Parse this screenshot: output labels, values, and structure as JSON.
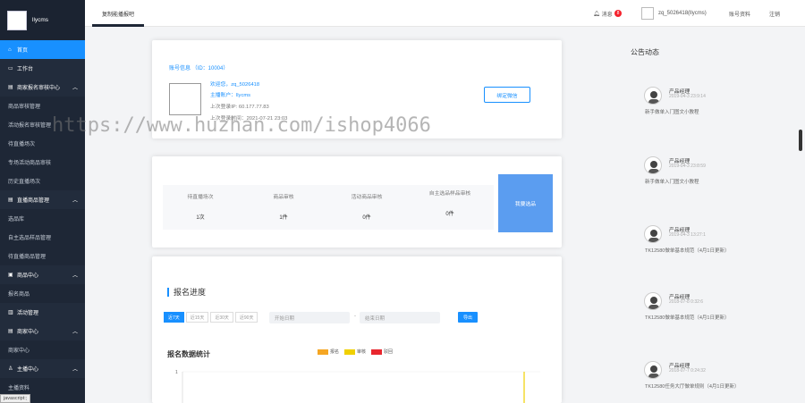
{
  "sidebar": {
    "brand": "llycms",
    "items": [
      {
        "label": "首页",
        "icon": "⌂",
        "type": "active"
      },
      {
        "label": "工作台",
        "icon": "▭",
        "type": "group"
      },
      {
        "label": "商家报名审核中心",
        "icon": "▤",
        "type": "group",
        "caret": "︿"
      },
      {
        "label": "商品审核管理",
        "type": "item"
      },
      {
        "label": "活动报名审核管理",
        "type": "item"
      },
      {
        "label": "待直播场次",
        "type": "item"
      },
      {
        "label": "专场活动商品审核",
        "type": "item"
      },
      {
        "label": "历史直播场次",
        "type": "item"
      },
      {
        "label": "直播商品管理",
        "icon": "▤",
        "type": "group",
        "caret": "︿"
      },
      {
        "label": "选品库",
        "type": "item"
      },
      {
        "label": "自主选品样品管理",
        "type": "item"
      },
      {
        "label": "待直播商品管理",
        "type": "item"
      },
      {
        "label": "商品中心",
        "icon": "▣",
        "type": "group",
        "caret": "︿"
      },
      {
        "label": "报名商品",
        "type": "item"
      },
      {
        "label": "活动管理",
        "icon": "▥",
        "type": "group"
      },
      {
        "label": "商家中心",
        "icon": "▤",
        "type": "group",
        "caret": "︿"
      },
      {
        "label": "商家中心",
        "type": "item"
      },
      {
        "label": "主播中心",
        "icon": "♙",
        "type": "group",
        "caret": "︿"
      },
      {
        "label": "主播资料",
        "type": "item"
      }
    ],
    "status_text": "javascript:;"
  },
  "topbar": {
    "tab_label": "复制能播报吧",
    "bell_icon": "bell-icon",
    "messages_label": "消息",
    "messages_count": "8",
    "username": "zq_5026418(llycms)",
    "account_label": "账号资料",
    "logout_label": "注销"
  },
  "account": {
    "title": "账号信息 （ID：10004）",
    "welcome_prefix": "欢迎您，",
    "welcome_user": "zq_5026418",
    "anchor": "主播账户：llycms",
    "last_ip": "上次登录IP: 60.177.77.83",
    "last_time": "上次登录时间：2021-07-21 23:03",
    "bind_button": "绑定微信"
  },
  "stats": {
    "items": [
      {
        "label": "待直播场次",
        "value": "1次"
      },
      {
        "label": "商品审核",
        "value": "1件"
      },
      {
        "label": "活动商品审核",
        "value": "0件"
      },
      {
        "label": "自主选品样品审核",
        "value": "0件"
      }
    ],
    "action_button": "我要选品"
  },
  "progress": {
    "title": "报名进度",
    "ranges": [
      "近7天",
      "近15天",
      "近30天",
      "近90天"
    ],
    "start_placeholder": "开始日期",
    "separator": "-",
    "end_placeholder": "结束日期",
    "export_button": "导出",
    "chart_title": "报名数据统计"
  },
  "chart_data": {
    "type": "line",
    "title": "报名数据统计",
    "series": [
      {
        "name": "报名",
        "color": "#f5a623"
      },
      {
        "name": "审核",
        "color": "#f0d000"
      },
      {
        "name": "驳回",
        "color": "#e8262e"
      }
    ],
    "y_ticks": [
      "1"
    ],
    "legend_position": "top-center"
  },
  "announcements": {
    "title": "公告动态",
    "items": [
      {
        "name": "产品经理",
        "date": "2019-04-3 23:9:14",
        "text": "新手做单入门图文小教程"
      },
      {
        "name": "产品经理",
        "date": "2019-04-3 23:8:59",
        "text": "新手做单入门图文小教程"
      },
      {
        "name": "产品经理",
        "date": "2019-04-3 13:27:1",
        "text": "TK12580做单基本规范（4月1日更新）"
      },
      {
        "name": "产品经理",
        "date": "2018-07-8 0:32:6",
        "text": "TK12580做单基本规范（4月1日更新）"
      },
      {
        "name": "产品经理",
        "date": "2018-07-7 0:24:32",
        "text": "TK12580任务大厅做单规则（4月1日更新）"
      }
    ]
  },
  "watermark": "https://www.huzhan.com/ishop4066"
}
